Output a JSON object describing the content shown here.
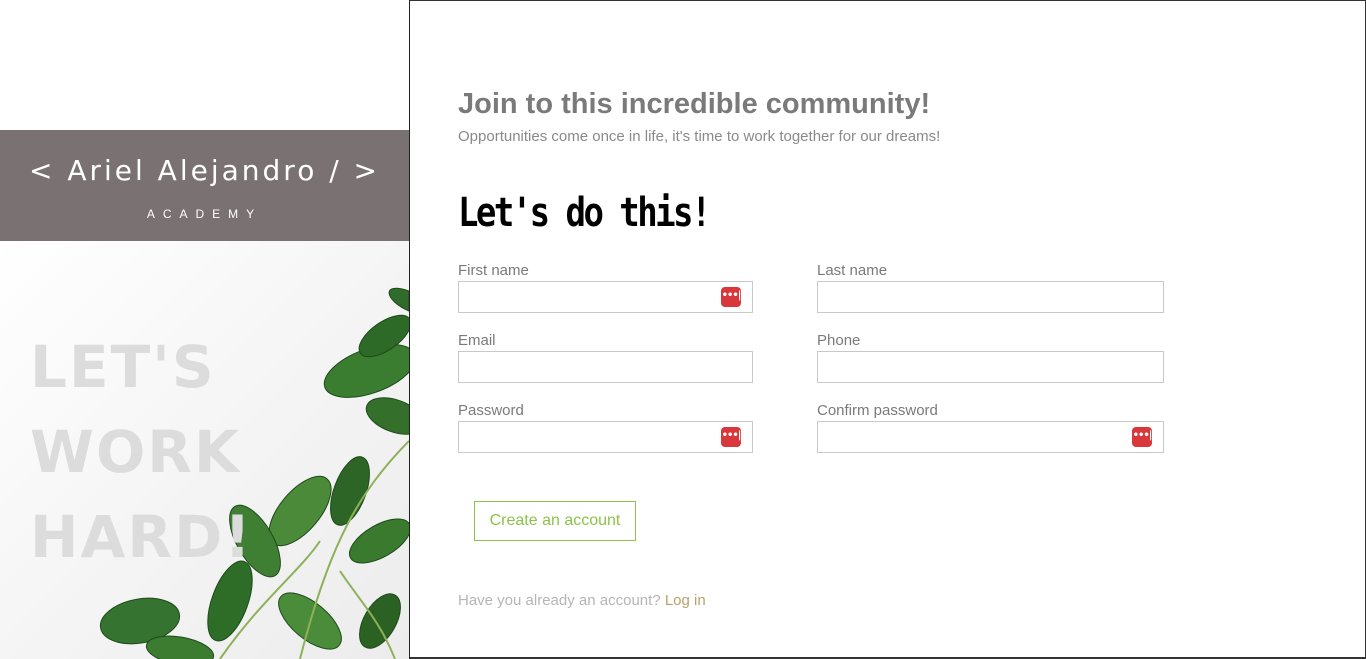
{
  "brand": {
    "name": "< Ariel Alejandro / >",
    "subtitle": "ACADEMY"
  },
  "hero": {
    "lines": [
      "LET'S",
      "WORK",
      "HARD!"
    ]
  },
  "main": {
    "headline": "Join to this incredible community!",
    "subline": "Opportunities come once in life, it's time to work together for our dreams!",
    "cta": "Let's do this!"
  },
  "form": {
    "first_name_label": "First name",
    "last_name_label": "Last name",
    "email_label": "Email",
    "phone_label": "Phone",
    "password_label": "Password",
    "confirm_password_label": "Confirm password",
    "submit_label": "Create an account"
  },
  "footer": {
    "prompt": "Have you already an account?",
    "login_link": "Log in"
  },
  "icons": {
    "password_manager": "password-manager-icon"
  },
  "colors": {
    "brand_bg": "#7a7272",
    "accent_green": "#8bc34a",
    "link_gold": "#b8a06a",
    "pm_red": "#d8373b"
  }
}
